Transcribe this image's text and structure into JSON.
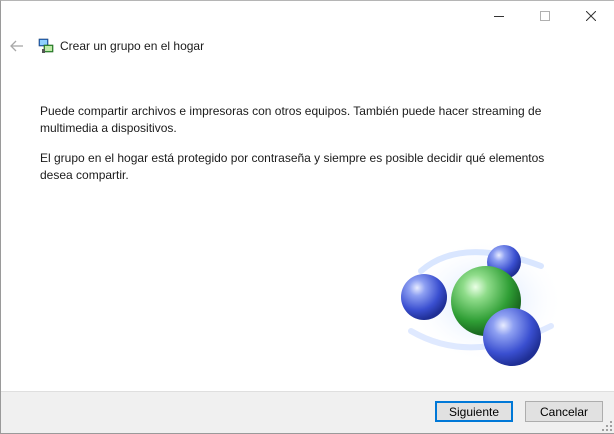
{
  "window": {
    "title": "Crear un grupo en el hogar",
    "caption_buttons": [
      "minimize",
      "maximize",
      "close"
    ]
  },
  "header": {
    "back_icon": "back-arrow-icon",
    "app_icon": "homegroup-icon"
  },
  "content": {
    "paragraph1": "Puede compartir archivos e impresoras con otros equipos. También puede hacer streaming de multimedia a dispositivos.",
    "paragraph2": "El grupo en el hogar está protegido por contraseña y siempre es posible decidir qué elementos desea compartir."
  },
  "illustration": "homegroup-spheres-illustration",
  "footer": {
    "next_label": "Siguiente",
    "cancel_label": "Cancelar"
  },
  "colors": {
    "accent": "#0078d7",
    "footer_bg": "#f0f0f0",
    "sphere_blue": "#3c56d6",
    "sphere_green": "#2fa53a"
  }
}
